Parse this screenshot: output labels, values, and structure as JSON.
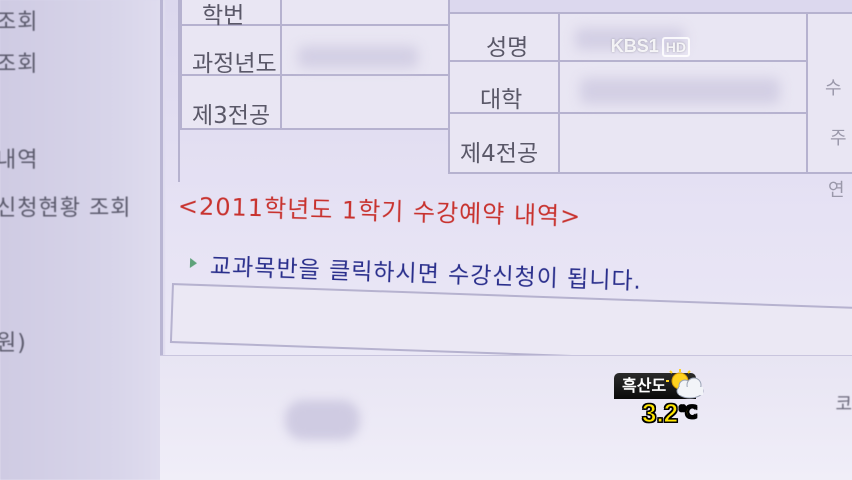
{
  "sidebar": {
    "items": [
      "조회",
      "조회",
      "내역",
      "신청현황 조회",
      "원)"
    ]
  },
  "info_table": {
    "header_top": "학번",
    "labels": {
      "year": "과정년도",
      "name": "성명",
      "college": "대학",
      "major3": "제3전공",
      "major4": "제4전공"
    },
    "right_edge": [
      "수",
      "주",
      "연"
    ]
  },
  "headline": "<2011학년도 1학기 수강예약 내역>",
  "notice": "교과목반을 클릭하시면 수강신청이 됩니다.",
  "edge_mark": "코",
  "broadcast": {
    "channel": "KBS1",
    "quality": "HD"
  },
  "weather": {
    "region": "흑산도",
    "icon": "sun-behind-cloud-icon",
    "temperature": "3.2",
    "unit": "℃"
  },
  "colors": {
    "headline": "#c8322e",
    "notice": "#2a2f8c",
    "temperature": "#ffe600"
  }
}
